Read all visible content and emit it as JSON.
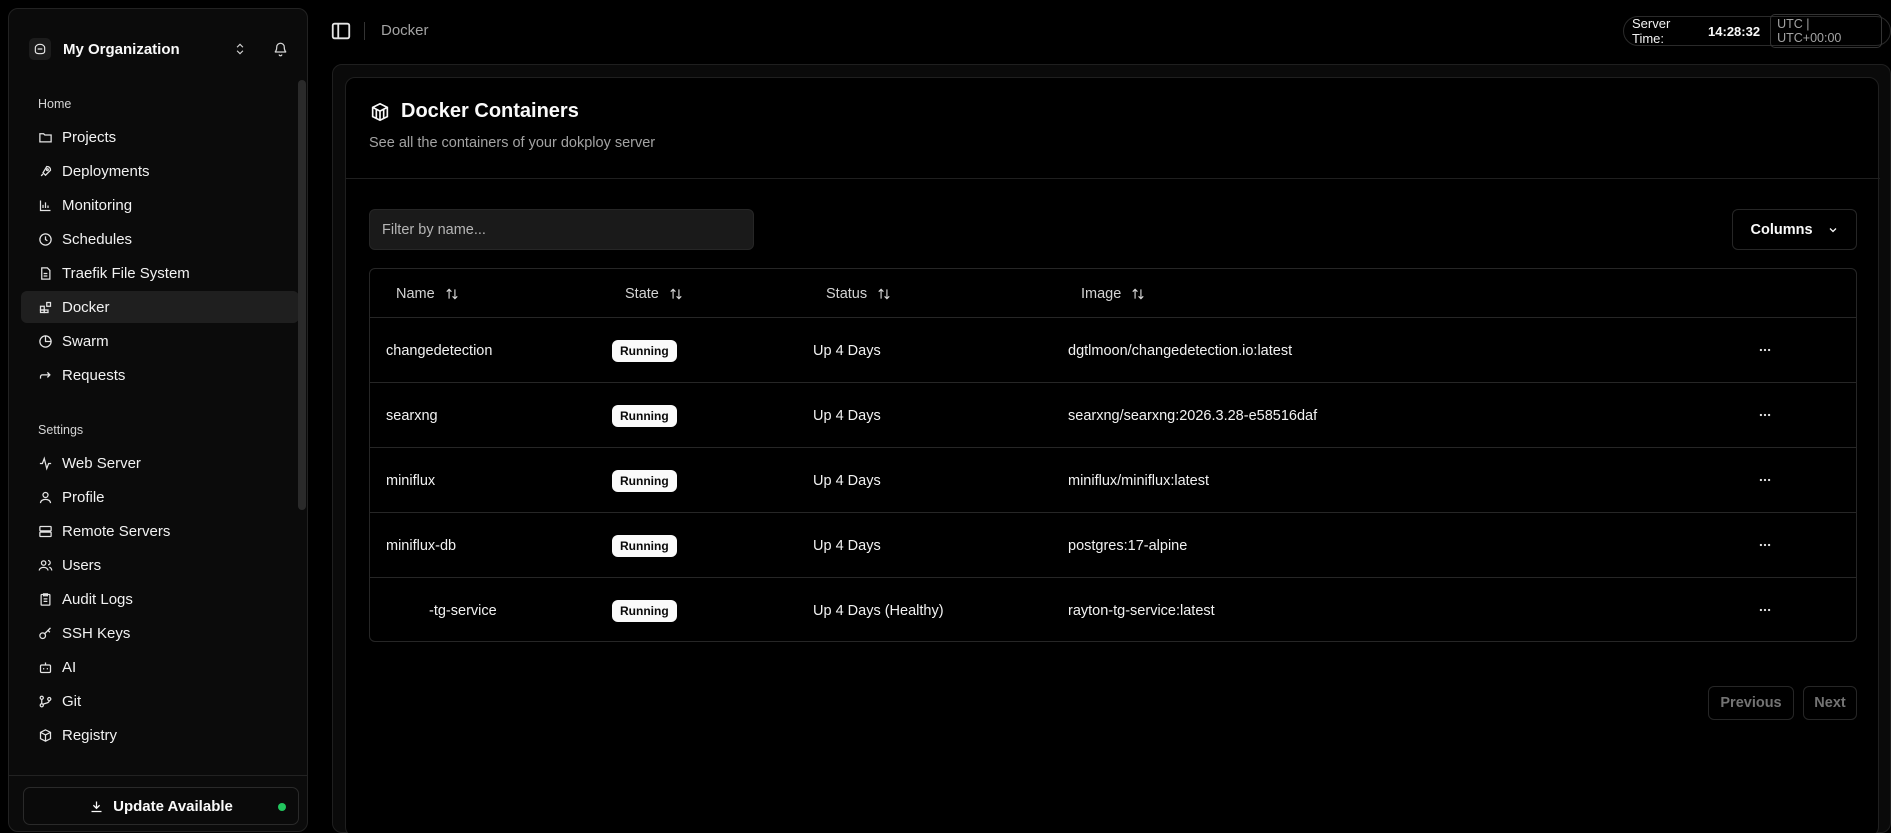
{
  "sidebar": {
    "org_name": "My Organization",
    "sections": [
      {
        "title": "Home",
        "items": [
          {
            "label": "Projects",
            "icon": "folder-icon"
          },
          {
            "label": "Deployments",
            "icon": "rocket-icon"
          },
          {
            "label": "Monitoring",
            "icon": "chart-icon"
          },
          {
            "label": "Schedules",
            "icon": "clock-icon"
          },
          {
            "label": "Traefik File System",
            "icon": "file-icon"
          },
          {
            "label": "Docker",
            "icon": "blocks-icon",
            "active": true
          },
          {
            "label": "Swarm",
            "icon": "pie-icon"
          },
          {
            "label": "Requests",
            "icon": "arrow-icon"
          }
        ]
      },
      {
        "title": "Settings",
        "items": [
          {
            "label": "Web Server",
            "icon": "activity-icon"
          },
          {
            "label": "Profile",
            "icon": "user-icon"
          },
          {
            "label": "Remote Servers",
            "icon": "server-icon"
          },
          {
            "label": "Users",
            "icon": "users-icon"
          },
          {
            "label": "Audit Logs",
            "icon": "clipboard-icon"
          },
          {
            "label": "SSH Keys",
            "icon": "key-icon"
          },
          {
            "label": "AI",
            "icon": "bot-icon"
          },
          {
            "label": "Git",
            "icon": "git-icon"
          },
          {
            "label": "Registry",
            "icon": "package-icon"
          }
        ]
      }
    ],
    "update_label": "Update Available"
  },
  "topbar": {
    "breadcrumb": "Docker",
    "server_time_label": "Server Time:",
    "server_time_value": "14:28:32",
    "timezone": "UTC | UTC+00:00"
  },
  "page": {
    "title": "Docker Containers",
    "subtitle": "See all the containers of your dokploy server",
    "filter_placeholder": "Filter by name...",
    "columns_label": "Columns"
  },
  "table": {
    "headers": [
      "Name",
      "State",
      "Status",
      "Image"
    ],
    "rows": [
      {
        "name": "changedetection",
        "state": "Running",
        "status": "Up 4 Days",
        "image": "dgtlmoon/changedetection.io:latest"
      },
      {
        "name": "searxng",
        "state": "Running",
        "status": "Up 4 Days",
        "image": "searxng/searxng:2026.3.28-e58516daf"
      },
      {
        "name": "miniflux",
        "state": "Running",
        "status": "Up 4 Days",
        "image": "miniflux/miniflux:latest"
      },
      {
        "name": "miniflux-db",
        "state": "Running",
        "status": "Up 4 Days",
        "image": "postgres:17-alpine"
      },
      {
        "name": "-tg-service",
        "state": "Running",
        "status": "Up 4 Days (Healthy)",
        "image": "rayton-tg-service:latest"
      }
    ]
  },
  "pagination": {
    "previous": "Previous",
    "next": "Next"
  },
  "colors": {
    "accent_dot": "#22c55e",
    "badge_bg": "#fafafa",
    "background": "#000000"
  }
}
